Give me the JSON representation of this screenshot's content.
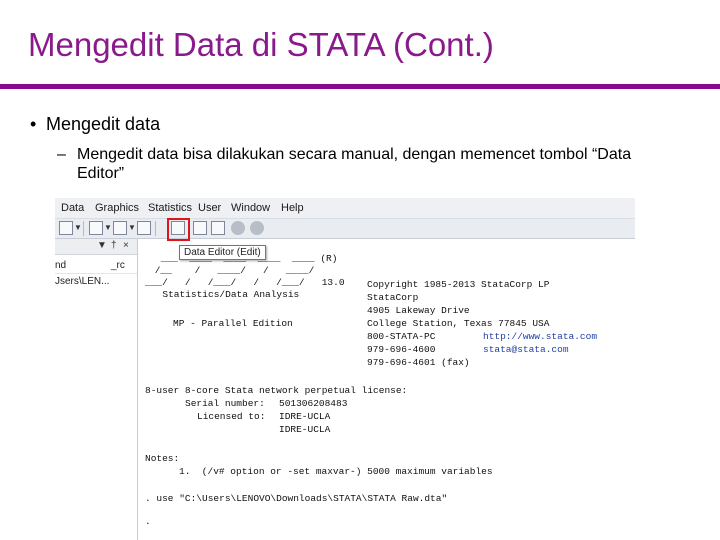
{
  "slide": {
    "title": "Mengedit Data di STATA (Cont.)",
    "bullet_main": "Mengedit data",
    "bullet_sub": "Mengedit data bisa dilakukan secara manual, dengan memencet tombol “Data Editor”"
  },
  "screenshot": {
    "menus": [
      "Data",
      "Graphics",
      "Statistics",
      "User",
      "Window",
      "Help"
    ],
    "tooltip": "Data Editor (Edit)",
    "left_pane": {
      "ctrl_pin": "▼",
      "ctrl_pushpin": "†",
      "ctrl_close": "×",
      "col_name": "nd",
      "col_ctrl": "_rc",
      "path": "Jsers\\LEN..."
    },
    "results": {
      "logo_1": " ___  ____  ____  ____  ____ (R)",
      "logo_2": " /__    /   ____/   /   ____/",
      "logo_3": "___/   /   /___/   /   /___/   13.0",
      "logo_4": "  Statistics/Data Analysis",
      "edition": "MP - Parallel Edition",
      "copyright": "Copyright 1985-2013 StataCorp LP",
      "company": "StataCorp",
      "address": "4905 Lakeway Drive",
      "city": "College Station, Texas 77845 USA",
      "phone_1": "800-STATA-PC",
      "website": "http://www.stata.com",
      "phone_2": "979-696-4600",
      "email": "stata@stata.com",
      "fax": "979-696-4601 (fax)",
      "license": "8-user 8-core Stata network perpetual license:",
      "serial_label": "Serial number:",
      "serial": "501306208483",
      "licensed_label": "Licensed to:",
      "licensed_1": "IDRE-UCLA",
      "licensed_2": "IDRE-UCLA",
      "notes_label": "Notes:",
      "note_1": "1.  (/v# option or -set maxvar-) 5000 maximum variables",
      "command": ". use \"C:\\Users\\LENOVO\\Downloads\\STATA\\STATA Raw.dta\"",
      "prompt": "."
    }
  }
}
